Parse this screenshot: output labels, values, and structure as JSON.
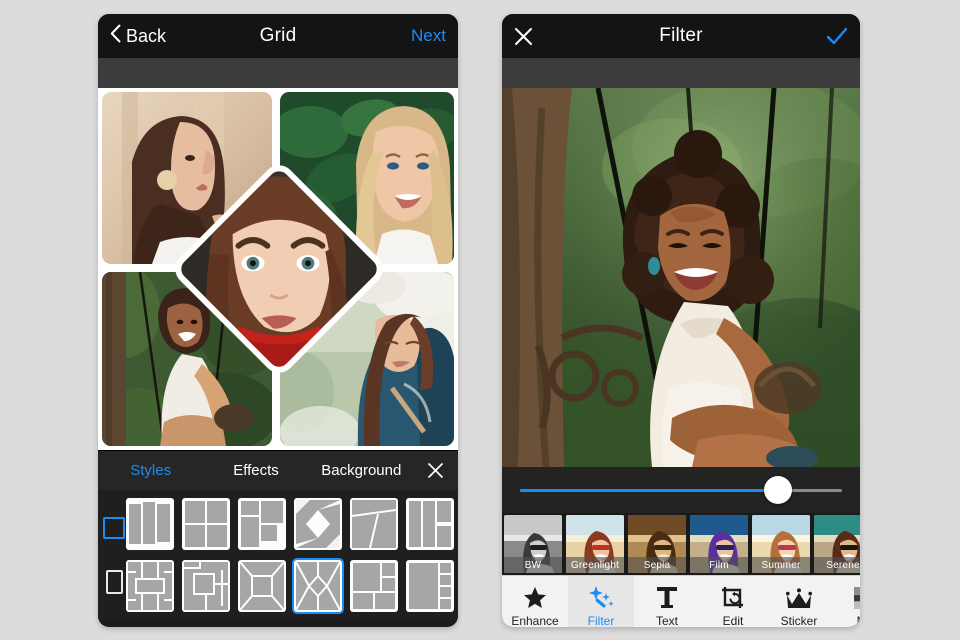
{
  "background_color": "#dcdcdc",
  "accent_color": "#1c8cf5",
  "left_panel": {
    "name": "grid-collage-editor",
    "navbar": {
      "back_label": "Back",
      "back_icon": "chevron-left-icon",
      "title": "Grid",
      "next_label": "Next"
    },
    "collage": {
      "cells": [
        {
          "id": "top-left",
          "description": "woman with long brown hair and gold earring in profile"
        },
        {
          "id": "top-right",
          "description": "smiling blonde woman in front of green leaves"
        },
        {
          "id": "center-diamond",
          "description": "woman with red scarf, blue-green eyes"
        },
        {
          "id": "bottom-left",
          "description": "smiling woman with curly hair sitting on garden swing"
        },
        {
          "id": "bottom-right",
          "description": "brunette woman in blue jacket under blossom tree"
        }
      ]
    },
    "tool_tabs": [
      {
        "label": "Styles",
        "active": true
      },
      {
        "label": "Effects",
        "active": false
      },
      {
        "label": "Background",
        "active": false
      }
    ],
    "close_icon": "close-icon",
    "aspect_buttons": [
      {
        "name": "aspect-square",
        "shape": "square",
        "selected": true
      },
      {
        "name": "aspect-portrait",
        "shape": "portrait",
        "selected": false
      }
    ],
    "templates_row_1": [
      {
        "id": "three-vertical-panels",
        "selected": false
      },
      {
        "id": "two-by-two-grid",
        "selected": false
      },
      {
        "id": "four-uneven-quads",
        "selected": false
      },
      {
        "id": "diamond-pinwheel",
        "selected": false
      },
      {
        "id": "three-angled-shards",
        "selected": false
      },
      {
        "id": "three-columns-split-right",
        "selected": false
      }
    ],
    "templates_row_2": [
      {
        "id": "center-horizontal-band",
        "selected": false
      },
      {
        "id": "nested-squares",
        "selected": false
      },
      {
        "id": "center-frame-x",
        "selected": false
      },
      {
        "id": "center-diamond",
        "selected": true
      },
      {
        "id": "left-large-two-right",
        "selected": false
      },
      {
        "id": "left-large-four-strips",
        "selected": false
      }
    ]
  },
  "right_panel": {
    "name": "filter-editor",
    "navbar": {
      "close_icon": "close-icon",
      "title": "Filter",
      "confirm_icon": "check-icon"
    },
    "preview": {
      "description": "smiling woman with curly hair sitting on a garden swing surrounded by greenery"
    },
    "slider": {
      "name": "filter-intensity-slider",
      "value_percent": 80
    },
    "filters": [
      {
        "label": "BW",
        "selected": false
      },
      {
        "label": "Greenlight",
        "selected": true
      },
      {
        "label": "Sepia",
        "selected": false
      },
      {
        "label": "Film",
        "selected": false
      },
      {
        "label": "Summer",
        "selected": false
      },
      {
        "label": "Serene",
        "selected": false
      }
    ],
    "bottom_tabs": [
      {
        "label": "Enhance",
        "icon": "star-icon",
        "active": false
      },
      {
        "label": "Filter",
        "icon": "magic-wand-icon",
        "active": true
      },
      {
        "label": "Text",
        "icon": "text-t-icon",
        "active": false
      },
      {
        "label": "Edit",
        "icon": "crop-rotate-icon",
        "active": false
      },
      {
        "label": "Sticker",
        "icon": "crown-icon",
        "active": false
      },
      {
        "label": "Mo",
        "icon": "grid-more-icon",
        "active": false
      }
    ]
  }
}
